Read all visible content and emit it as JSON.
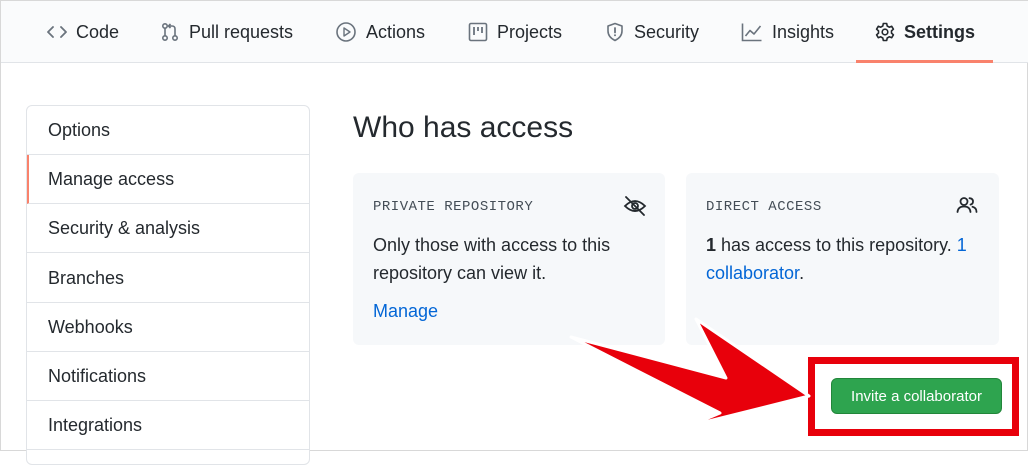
{
  "nav": {
    "tabs": [
      {
        "label": "Code",
        "icon": "code-icon"
      },
      {
        "label": "Pull requests",
        "icon": "pull-request-icon"
      },
      {
        "label": "Actions",
        "icon": "play-icon"
      },
      {
        "label": "Projects",
        "icon": "project-icon"
      },
      {
        "label": "Security",
        "icon": "shield-icon"
      },
      {
        "label": "Insights",
        "icon": "graph-icon"
      },
      {
        "label": "Settings",
        "icon": "gear-icon"
      }
    ],
    "active_tab": "Settings"
  },
  "sidebar": {
    "items": [
      {
        "label": "Options"
      },
      {
        "label": "Manage access"
      },
      {
        "label": "Security & analysis"
      },
      {
        "label": "Branches"
      },
      {
        "label": "Webhooks"
      },
      {
        "label": "Notifications"
      },
      {
        "label": "Integrations"
      }
    ],
    "selected": "Manage access"
  },
  "main": {
    "title": "Who has access",
    "private_box": {
      "heading": "PRIVATE REPOSITORY",
      "icon": "eye-closed-icon",
      "text": "Only those with access to this repository can view it.",
      "link": "Manage"
    },
    "direct_box": {
      "heading": "DIRECT ACCESS",
      "icon": "people-icon",
      "count": "1",
      "text": " has access to this repository. ",
      "link": "1 collaborator",
      "suffix": "."
    },
    "invite_button": "Invite a collaborator"
  },
  "colors": {
    "accent_underline": "#f9826c",
    "button_green": "#2ea44f",
    "link_blue": "#0366d6",
    "annotation_red": "#e8000b"
  }
}
